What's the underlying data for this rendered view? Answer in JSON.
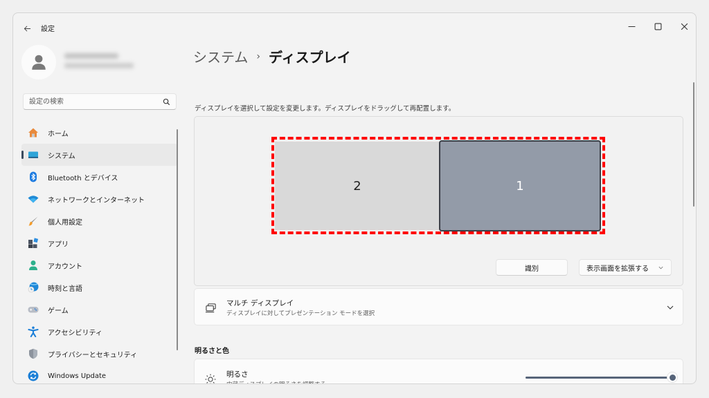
{
  "window": {
    "title": "設定",
    "controls": {
      "minimize": "minimize",
      "maximize": "maximize",
      "close": "close"
    }
  },
  "profile": {
    "avatar_icon": "person-icon",
    "name": "",
    "email": ""
  },
  "search": {
    "placeholder": "設定の検索",
    "value": ""
  },
  "sidebar": {
    "items": [
      {
        "label": "ホーム",
        "icon": "home-icon",
        "active": false
      },
      {
        "label": "システム",
        "icon": "system-icon",
        "active": true
      },
      {
        "label": "Bluetooth とデバイス",
        "icon": "bluetooth-icon",
        "active": false
      },
      {
        "label": "ネットワークとインターネット",
        "icon": "wifi-icon",
        "active": false
      },
      {
        "label": "個人用設定",
        "icon": "brush-icon",
        "active": false
      },
      {
        "label": "アプリ",
        "icon": "apps-icon",
        "active": false
      },
      {
        "label": "アカウント",
        "icon": "account-icon",
        "active": false
      },
      {
        "label": "時刻と言語",
        "icon": "time-language-icon",
        "active": false
      },
      {
        "label": "ゲーム",
        "icon": "gamepad-icon",
        "active": false
      },
      {
        "label": "アクセシビリティ",
        "icon": "accessibility-icon",
        "active": false
      },
      {
        "label": "プライバシーとセキュリティ",
        "icon": "shield-icon",
        "active": false
      },
      {
        "label": "Windows Update",
        "icon": "update-icon",
        "active": false
      }
    ]
  },
  "breadcrumb": {
    "parent": "システム",
    "separator": "›",
    "current": "ディスプレイ"
  },
  "arrangement": {
    "description": "ディスプレイを選択して設定を変更します。ディスプレイをドラッグして再配置します。",
    "monitors": [
      {
        "number": "2",
        "selected": false
      },
      {
        "number": "1",
        "selected": true
      }
    ],
    "identify_label": "識別",
    "mode_select": "表示画面を拡張する"
  },
  "multi_display": {
    "title": "マルチ ディスプレイ",
    "subtitle": "ディスプレイに対してプレゼンテーション モードを選択"
  },
  "brightness_section": {
    "heading": "明るさと色",
    "title": "明るさ",
    "subtitle": "内蔵ディスプレイの明るさを調整する",
    "value_percent": 100
  },
  "colors": {
    "accent": "#566479",
    "highlight": "#ff0000",
    "selected_monitor": "#939ba8",
    "monitor": "#d9d9d9"
  }
}
